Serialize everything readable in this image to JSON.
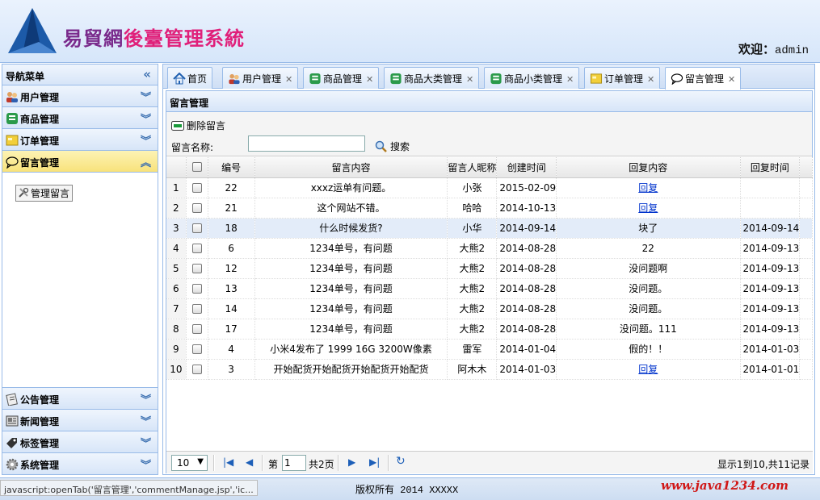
{
  "header": {
    "title_part1": "易貿網",
    "title_part2": "後臺管理系統",
    "welcome_label": "欢迎：",
    "username": "admin"
  },
  "nav": {
    "title": "导航菜单",
    "sections_top": [
      {
        "label": "用户管理",
        "icon": "users-icon"
      },
      {
        "label": "商品管理",
        "icon": "goods-icon"
      },
      {
        "label": "订单管理",
        "icon": "order-icon"
      },
      {
        "label": "留言管理",
        "icon": "comment-icon"
      }
    ],
    "active_section_item": "管理留言",
    "sections_bottom": [
      {
        "label": "公告管理",
        "icon": "notice-icon"
      },
      {
        "label": "新闻管理",
        "icon": "news-icon"
      },
      {
        "label": "标签管理",
        "icon": "tag-icon"
      },
      {
        "label": "系统管理",
        "icon": "system-icon"
      }
    ]
  },
  "tabs": [
    {
      "label": "首页",
      "closable": false
    },
    {
      "label": "用户管理",
      "closable": true
    },
    {
      "label": "商品管理",
      "closable": true
    },
    {
      "label": "商品大类管理",
      "closable": true
    },
    {
      "label": "商品小类管理",
      "closable": true
    },
    {
      "label": "订单管理",
      "closable": true
    },
    {
      "label": "留言管理",
      "closable": true
    }
  ],
  "panel": {
    "title": "留言管理",
    "delete_label": "删除留言",
    "search_label": "留言名称:",
    "search_value": "",
    "search_button": "搜索"
  },
  "grid": {
    "columns": [
      "编号",
      "留言内容",
      "留言人昵称",
      "创建时间",
      "回复内容",
      "回复时间"
    ],
    "rows": [
      {
        "n": "1",
        "id": "22",
        "content": "xxxz运单有问题。",
        "user": "小张",
        "created": "2015-02-09",
        "reply": "回复",
        "reply_link": true,
        "reply_time": ""
      },
      {
        "n": "2",
        "id": "21",
        "content": "这个网站不错。",
        "user": "哈哈",
        "created": "2014-10-13",
        "reply": "回复",
        "reply_link": true,
        "reply_time": ""
      },
      {
        "n": "3",
        "id": "18",
        "content": "什么时候发货?",
        "user": "小华",
        "created": "2014-09-14",
        "reply": "块了",
        "reply_link": false,
        "reply_time": "2014-09-14"
      },
      {
        "n": "4",
        "id": "6",
        "content": "1234单号，有问题",
        "user": "大熊2",
        "created": "2014-08-28",
        "reply": "22",
        "reply_link": false,
        "reply_time": "2014-09-13"
      },
      {
        "n": "5",
        "id": "12",
        "content": "1234单号，有问题",
        "user": "大熊2",
        "created": "2014-08-28",
        "reply": "没问题啊",
        "reply_link": false,
        "reply_time": "2014-09-13"
      },
      {
        "n": "6",
        "id": "13",
        "content": "1234单号，有问题",
        "user": "大熊2",
        "created": "2014-08-28",
        "reply": "没问题。",
        "reply_link": false,
        "reply_time": "2014-09-13"
      },
      {
        "n": "7",
        "id": "14",
        "content": "1234单号，有问题",
        "user": "大熊2",
        "created": "2014-08-28",
        "reply": "没问题。",
        "reply_link": false,
        "reply_time": "2014-09-13"
      },
      {
        "n": "8",
        "id": "17",
        "content": "1234单号，有问题",
        "user": "大熊2",
        "created": "2014-08-28",
        "reply": "没问题。111",
        "reply_link": false,
        "reply_time": "2014-09-13"
      },
      {
        "n": "9",
        "id": "4",
        "content": "小米4发布了 1999 16G 3200W像素",
        "user": "雷军",
        "created": "2014-01-04",
        "reply": "假的！！",
        "reply_link": false,
        "reply_time": "2014-01-03"
      },
      {
        "n": "10",
        "id": "3",
        "content": "开始配货开始配货开始配货开始配货",
        "user": "阿木木",
        "created": "2014-01-03",
        "reply": "回复",
        "reply_link": true,
        "reply_time": "2014-01-01"
      }
    ]
  },
  "pager": {
    "page_size": "10",
    "page_prefix": "第",
    "page_value": "1",
    "page_total": "共2页",
    "info": "显示1到10,共11记录"
  },
  "status": {
    "js_link": "javascript:openTab('留言管理','commentManage.jsp','ic...",
    "copyright": "版权所有 2014 XXXXX",
    "watermark": "www.java1234.com"
  },
  "colors": {
    "border": "#99bbe8",
    "link": "#0033cc",
    "active_section": "#f8e27b",
    "title_purple": "#7a2b8c",
    "title_pink": "#e0207a",
    "watermark": "#d01818"
  }
}
